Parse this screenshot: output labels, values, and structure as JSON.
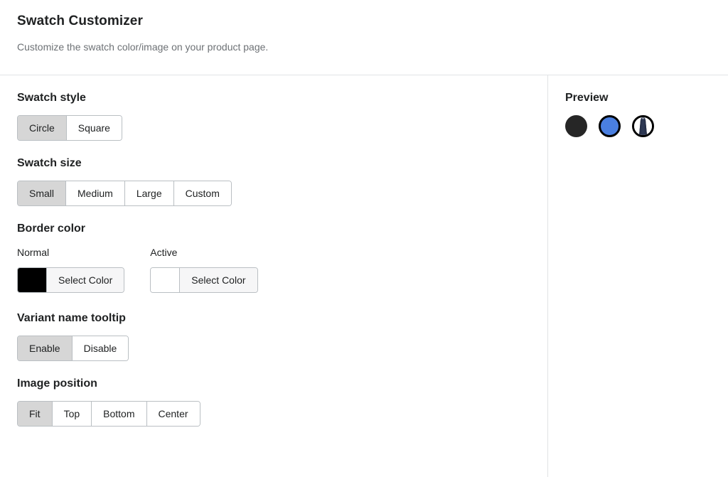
{
  "header": {
    "title": "Swatch Customizer",
    "subtitle": "Customize the swatch color/image on your product page."
  },
  "sections": {
    "swatch_style": {
      "title": "Swatch style",
      "options": [
        {
          "label": "Circle",
          "selected": true
        },
        {
          "label": "Square",
          "selected": false
        }
      ]
    },
    "swatch_size": {
      "title": "Swatch size",
      "options": [
        {
          "label": "Small",
          "selected": true
        },
        {
          "label": "Medium",
          "selected": false
        },
        {
          "label": "Large",
          "selected": false
        },
        {
          "label": "Custom",
          "selected": false
        }
      ]
    },
    "border_color": {
      "title": "Border color",
      "fields": [
        {
          "label": "Normal",
          "color": "#000000",
          "button_label": "Select Color"
        },
        {
          "label": "Active",
          "color": "#ffffff",
          "button_label": "Select Color"
        }
      ]
    },
    "variant_name_tooltip": {
      "title": "Variant name tooltip",
      "options": [
        {
          "label": "Enable",
          "selected": true
        },
        {
          "label": "Disable",
          "selected": false
        }
      ]
    },
    "image_position": {
      "title": "Image position",
      "options": [
        {
          "label": "Fit",
          "selected": true
        },
        {
          "label": "Top",
          "selected": false
        },
        {
          "label": "Bottom",
          "selected": false
        },
        {
          "label": "Center",
          "selected": false
        }
      ]
    }
  },
  "preview": {
    "title": "Preview",
    "swatches": [
      {
        "kind": "solid",
        "color": "#262626",
        "border_color": "#262626"
      },
      {
        "kind": "solid-bordered",
        "color": "#4a7fe0",
        "border_color": "#000000"
      },
      {
        "kind": "image",
        "color": "#2b3550",
        "border_color": "#000000"
      }
    ]
  },
  "colors": {
    "divider": "#e1e3e5",
    "border": "#babfc3",
    "selected_segment": "#d6d6d6",
    "field_background": "#f6f6f7",
    "text": "#202223",
    "muted_text": "#6d7175"
  }
}
